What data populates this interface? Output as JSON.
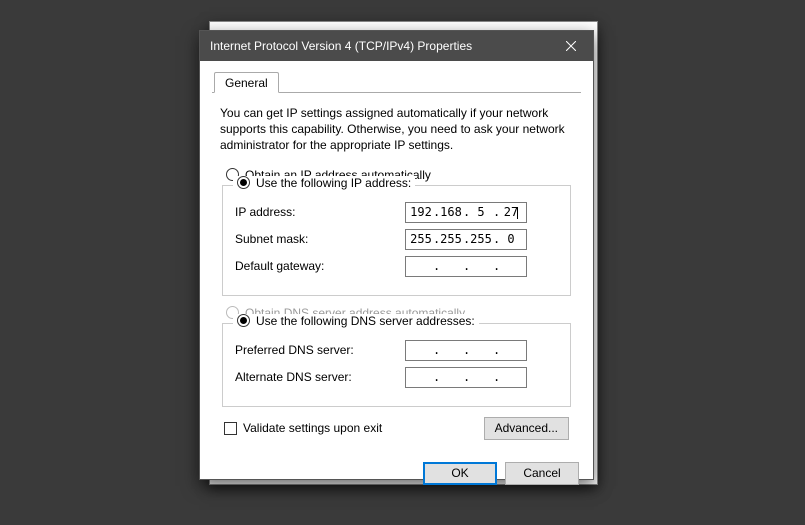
{
  "window": {
    "title": "Internet Protocol Version 4 (TCP/IPv4) Properties"
  },
  "tabs": {
    "general": "General"
  },
  "intro": "You can get IP settings assigned automatically if your network supports this capability. Otherwise, you need to ask your network administrator for the appropriate IP settings.",
  "ip": {
    "radio_auto": "Obtain an IP address automatically",
    "radio_manual": "Use the following IP address:",
    "addr_label": "IP address:",
    "addr": {
      "o1": "192",
      "o2": "168",
      "o3": "5",
      "o4": "27"
    },
    "mask_label": "Subnet mask:",
    "mask": {
      "o1": "255",
      "o2": "255",
      "o3": "255",
      "o4": "0"
    },
    "gw_label": "Default gateway:",
    "gw": {
      "o1": "",
      "o2": "",
      "o3": "",
      "o4": ""
    }
  },
  "dns": {
    "radio_auto": "Obtain DNS server address automatically",
    "radio_manual": "Use the following DNS server addresses:",
    "pref_label": "Preferred DNS server:",
    "pref": {
      "o1": "",
      "o2": "",
      "o3": "",
      "o4": ""
    },
    "alt_label": "Alternate DNS server:",
    "alt": {
      "o1": "",
      "o2": "",
      "o3": "",
      "o4": ""
    }
  },
  "validate_label": "Validate settings upon exit",
  "advanced_label": "Advanced...",
  "ok_label": "OK",
  "cancel_label": "Cancel"
}
